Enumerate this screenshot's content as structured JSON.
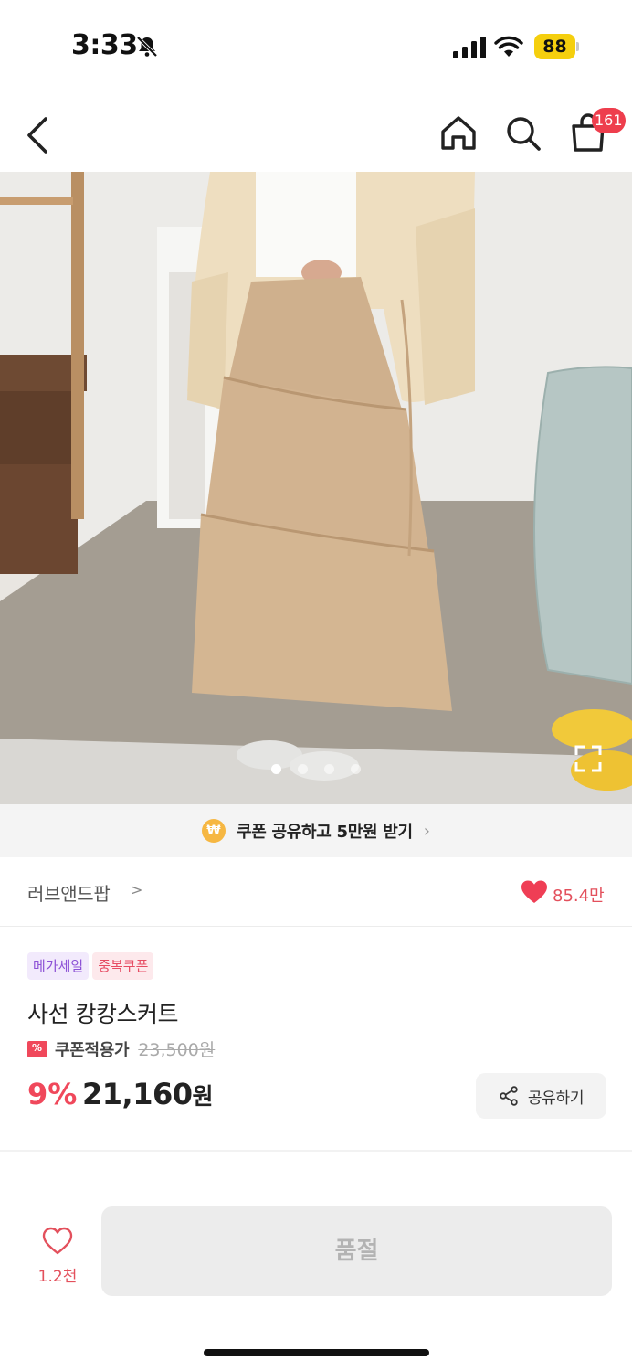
{
  "status_bar": {
    "time": "3:33",
    "battery": "88"
  },
  "nav": {
    "cart_badge": "161"
  },
  "gallery": {
    "dot_count": 4,
    "active_index": 0
  },
  "coupon_banner": {
    "text": "쿠폰 공유하고 5만원 받기",
    "coin": "₩"
  },
  "brand": {
    "name": "러브앤드팝",
    "chevron": ">",
    "likes": "85.4만"
  },
  "product": {
    "tags": [
      "메가세일",
      "중복쿠폰"
    ],
    "name": "사선 캉캉스커트",
    "coupon_label": "쿠폰적용가",
    "original_price": "23,500원",
    "discount": "9%",
    "price": "21,160",
    "price_unit": "원",
    "share_label": "공유하기"
  },
  "bottom_bar": {
    "wish_count": "1.2천",
    "cta_label": "품절"
  },
  "colors": {
    "accent": "#f0485b",
    "like": "#e3505c",
    "coupon_coin": "#f6b742"
  }
}
